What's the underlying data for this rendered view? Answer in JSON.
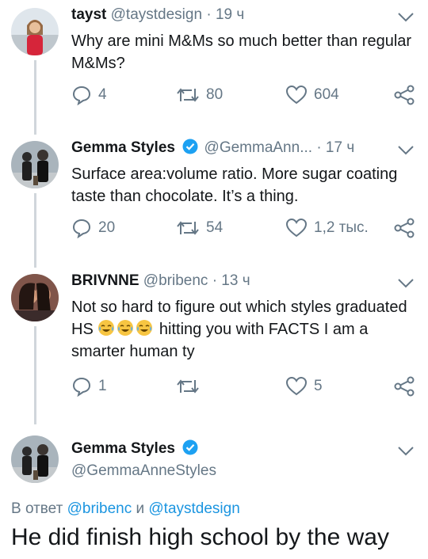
{
  "tweets": [
    {
      "name": "tayst",
      "handle": "@taystdesign",
      "dot": "·",
      "time": "19 ч",
      "text": "Why are mini M&Ms so much better than regular M&Ms?",
      "replies": "4",
      "retweets": "80",
      "likes": "604"
    },
    {
      "name": "Gemma Styles",
      "handle": "@GemmaAnn...",
      "dot": "·",
      "time": "17 ч",
      "text": "Surface area:volume ratio. More sugar coating taste than chocolate. It’s a thing.",
      "replies": "20",
      "retweets": "54",
      "likes": "1,2 тыс."
    },
    {
      "name": "BRIVNNE",
      "handle": "@bribenc",
      "dot": "·",
      "time": "13 ч",
      "text_before": "Not so hard to figure out which styles graduated HS ",
      "text_after": " hitting you with FACTS I am a smarter human ty",
      "replies": "1",
      "retweets": "",
      "likes": "5"
    }
  ],
  "main_tweet": {
    "name": "Gemma Styles",
    "handle": "@GemmaAnneStyles",
    "reply_prefix": "В ответ ",
    "mention_1": "@bribenc",
    "conjunction": " и ",
    "mention_2": "@taystdesign",
    "text": "He did finish high school by the way"
  },
  "icons": {
    "reply": "reply-icon",
    "retweet": "retweet-icon",
    "like": "heart-icon",
    "share": "share-icon",
    "verified": "verified-badge-icon",
    "menu": "chevron-down-icon",
    "emoji": "tears-of-joy-emoji-icon"
  },
  "colors": {
    "text": "#14171a",
    "secondary": "#657786",
    "link": "#1b95e0",
    "verified": "#1da1f2",
    "thread_line": "#d0d6db"
  }
}
